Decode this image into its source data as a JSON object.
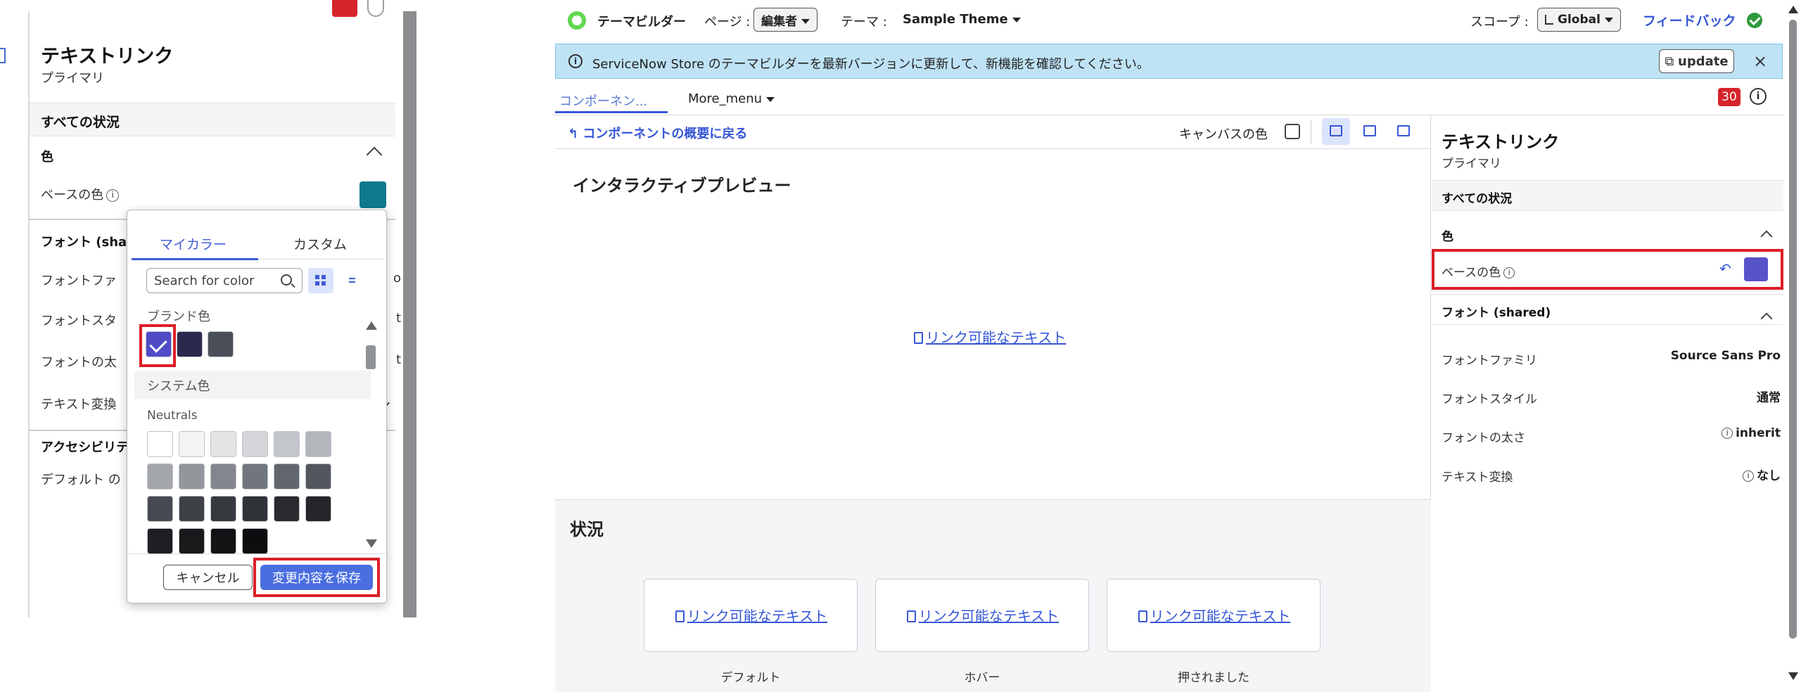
{
  "left_panel": {
    "title": "テキストリンク",
    "subtitle": "プライマリ",
    "all_states": "すべての状況",
    "color_section": "色",
    "base_color_label": "ベースの色",
    "base_color_value": "#0f7a8c",
    "font_section_partial": "フォント (sha",
    "rows": [
      "フォントファ",
      "フォントスタ",
      "フォントの太",
      "テキスト変換"
    ],
    "row_edge_values": [
      "o",
      "t",
      "t",
      ""
    ],
    "accessibility_partial": "アクセシビリテ",
    "default_partial": "デフォルト の"
  },
  "color_picker": {
    "tab_my_colors": "マイカラー",
    "tab_custom": "カスタム",
    "search_placeholder": "Search for color",
    "brand_colors_label": "ブランド色",
    "system_colors_label": "システム色",
    "neutrals_label": "Neutrals",
    "brand_swatches": [
      "#4f4bc7",
      "#2b2a4e",
      "#4a4f5a"
    ],
    "neutral_swatches": [
      [
        "#ffffff",
        "#f4f4f5",
        "#e3e4e6",
        "#d3d5d8",
        "#c3c6ca",
        "#b3b6bb"
      ],
      [
        "#a3a6ab",
        "#93979c",
        "#83878d",
        "#71767c",
        "#61666c",
        "#52575d"
      ],
      [
        "#474b51",
        "#3e4247",
        "#36393e",
        "#2f3236",
        "#292b2f",
        "#232528"
      ],
      [
        "#1d1f22",
        "#17191b",
        "#121315",
        "#0c0d0e"
      ]
    ],
    "cancel_label": "キャンセル",
    "save_label": "変更内容を保存"
  },
  "topbar": {
    "app_name": "テーマビルダー",
    "page_label": "ページ :",
    "page_value": "編集者",
    "theme_label": "テーマ :",
    "theme_value": "Sample Theme",
    "scope_label": "スコープ :",
    "scope_value": "Global",
    "feedback": "フィードバック"
  },
  "banner": {
    "text": "ServiceNow Store のテーマビルダーを最新バージョンに更新して、新機能を確認してください。",
    "update_label": "update",
    "close": "×"
  },
  "tabs": {
    "component": "コンポーネン...",
    "more_menu": "More_menu",
    "badge_count": "30"
  },
  "canvas": {
    "back_link": "コンポーネントの概要に戻る",
    "canvas_color_label": "キャンバスの色",
    "preview_title": "インタラクティブプレビュー",
    "link_text": "リンク可能なテキスト",
    "states_title": "状況",
    "states": [
      {
        "label": "デフォルト",
        "link": "リンク可能なテキスト"
      },
      {
        "label": "ホバー",
        "link": "リンク可能なテキスト"
      },
      {
        "label": "押されました",
        "link": "リンク可能なテキスト"
      }
    ]
  },
  "properties": {
    "title": "テキストリンク",
    "subtitle": "プライマリ",
    "all_states": "すべての状況",
    "color_section": "色",
    "base_color_label": "ベースの色",
    "base_color_value": "#5753c9",
    "font_section": "フォント (shared)",
    "font_family_label": "フォントファミリ",
    "font_family_value": "Source Sans Pro",
    "font_style_label": "フォントスタイル",
    "font_style_value": "通常",
    "font_weight_label": "フォントの太さ",
    "font_weight_value": "inherit",
    "text_transform_label": "テキスト変換",
    "text_transform_value": "なし"
  }
}
